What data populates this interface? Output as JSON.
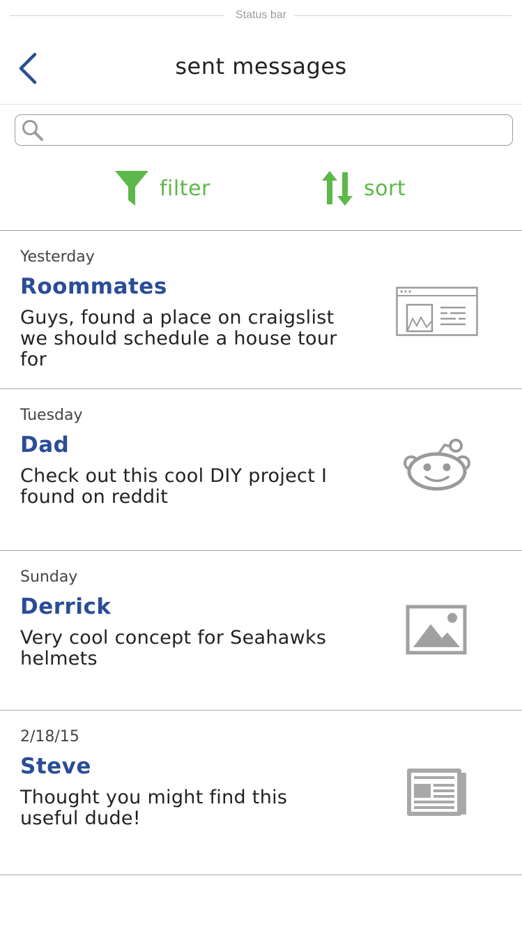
{
  "status_bar": {
    "label": "Status bar"
  },
  "header": {
    "title": "sent messages",
    "back_icon": "chevron-left-icon"
  },
  "search": {
    "placeholder": "",
    "value": "",
    "icon": "search-icon"
  },
  "toolbar": {
    "filter_label": "filter",
    "sort_label": "sort",
    "accent_color": "#5cb84a"
  },
  "messages": [
    {
      "date": "Yesterday",
      "name": "Roommates",
      "text": "Guys, found a place on craigslist we should schedule a house tour for",
      "thumbnail": "webpage-icon"
    },
    {
      "date": "Tuesday",
      "name": "Dad",
      "text": "Check out this cool DIY project I found on reddit",
      "thumbnail": "reddit-icon"
    },
    {
      "date": "Sunday",
      "name": "Derrick",
      "text": "Very cool concept for Seahawks helmets",
      "thumbnail": "image-icon"
    },
    {
      "date": "2/18/15",
      "name": "Steve",
      "text": "Thought you might find this useful dude!",
      "thumbnail": "newspaper-icon"
    }
  ],
  "colors": {
    "name": "#2a4d96",
    "back": "#2a4d96",
    "icon_gray": "#9a9a9a"
  }
}
